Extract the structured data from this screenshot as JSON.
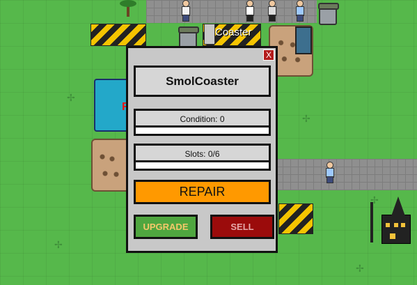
{
  "scene": {
    "sign_text": "Coaster"
  },
  "modal": {
    "close_label": "X",
    "ride_name": "SmolCoaster",
    "condition": {
      "label": "Condition: 0",
      "value": 0
    },
    "slots": {
      "label": "Slots: 0/6",
      "used": 0,
      "capacity": 6
    },
    "repair_label": "REPAIR",
    "upgrade_label": "UPGRADE",
    "sell_label": "SELL"
  },
  "colors": {
    "grass": "#56b84b",
    "repair": "#ff9900",
    "upgrade": "#4fa63f",
    "sell": "#9b0b0b",
    "close": "#b31b1b"
  }
}
